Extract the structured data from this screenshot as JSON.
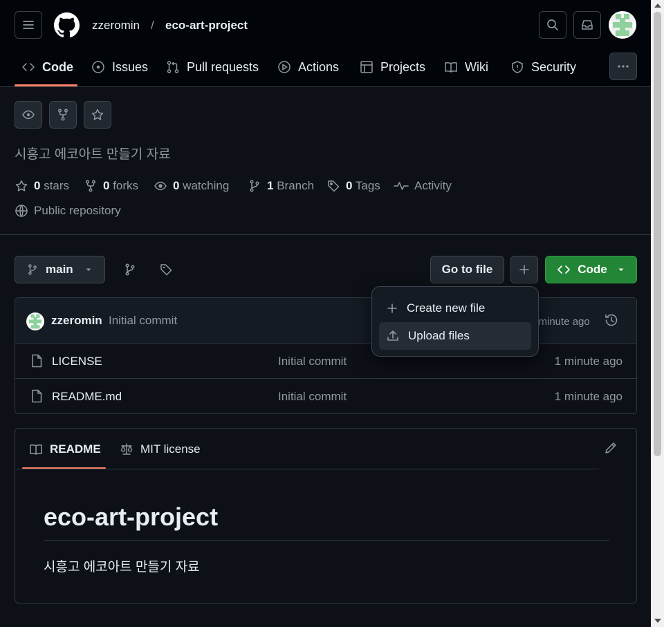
{
  "header": {
    "owner": "zzeromin",
    "separator": "/",
    "repo": "eco-art-project"
  },
  "tabs": [
    {
      "label": "Code",
      "icon": "code-icon"
    },
    {
      "label": "Issues",
      "icon": "issue-icon"
    },
    {
      "label": "Pull requests",
      "icon": "pull-request-icon"
    },
    {
      "label": "Actions",
      "icon": "play-icon"
    },
    {
      "label": "Projects",
      "icon": "table-icon"
    },
    {
      "label": "Wiki",
      "icon": "book-icon"
    },
    {
      "label": "Security",
      "icon": "shield-icon"
    }
  ],
  "repo": {
    "description": "시흥고 에코아트 만들기 자료",
    "stats": {
      "stars_count": "0",
      "stars_label": "stars",
      "forks_count": "0",
      "forks_label": "forks",
      "watching_count": "0",
      "watching_label": "watching",
      "branch_count": "1",
      "branch_label": "Branch",
      "tags_count": "0",
      "tags_label": "Tags",
      "activity_label": "Activity"
    },
    "visibility": "Public repository"
  },
  "branch_bar": {
    "branch": "main",
    "goto_label": "Go to file",
    "code_label": "Code"
  },
  "dropdown": {
    "items": [
      {
        "label": "Create new file",
        "icon": "plus-icon"
      },
      {
        "label": "Upload files",
        "icon": "upload-icon"
      }
    ]
  },
  "latest_commit": {
    "author": "zzeromin",
    "message": "Initial commit",
    "time": "1 minute ago"
  },
  "files": [
    {
      "name": "LICENSE",
      "message": "Initial commit",
      "time": "1 minute ago"
    },
    {
      "name": "README.md",
      "message": "Initial commit",
      "time": "1 minute ago"
    }
  ],
  "readme": {
    "tab_readme": "README",
    "tab_license": "MIT license",
    "title": "eco-art-project",
    "body": "시흥고 에코아트 만들기 자료"
  },
  "colors": {
    "background": "#0d1117",
    "accent": "#f78166",
    "primary_button": "#238636",
    "muted_text": "#9198a1"
  }
}
